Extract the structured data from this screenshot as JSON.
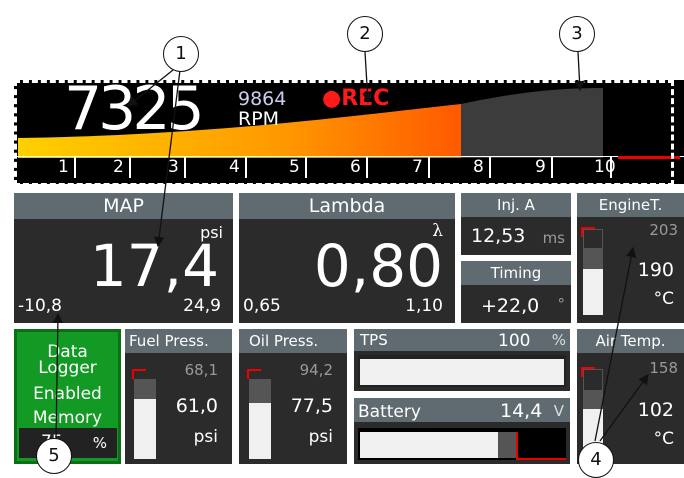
{
  "rpm": {
    "value": "7325",
    "peak": "9864",
    "unit": "RPM",
    "rec": "●REC",
    "scale": [
      "1",
      "2",
      "3",
      "4",
      "5",
      "6",
      "7",
      "8",
      "9",
      "10"
    ]
  },
  "map": {
    "title": "MAP",
    "value": "17,4",
    "unit": "psi",
    "min": "-10,8",
    "max": "24,9"
  },
  "lambda": {
    "title": "Lambda",
    "value": "0,80",
    "unit": "λ",
    "min": "0,65",
    "max": "1,10"
  },
  "inj": {
    "title": "Inj. A",
    "value": "12,53",
    "unit": "ms"
  },
  "timing": {
    "title": "Timing",
    "value": "+22,0",
    "unit": "°"
  },
  "enginet": {
    "title": "EngineT.",
    "max": "203",
    "value": "190",
    "unit": "°C",
    "fill": 0.55
  },
  "logger": {
    "line1": "Data",
    "line2": "Logger",
    "line3": "Enabled",
    "line4": "Memory",
    "value": "75",
    "unit": "%"
  },
  "fuel": {
    "title": "Fuel Press.",
    "max": "68,1",
    "value": "61,0",
    "unit": "psi",
    "fill": 0.85
  },
  "oil": {
    "title": "Oil Press.",
    "max": "94,2",
    "value": "77,5",
    "unit": "psi",
    "fill": 0.8
  },
  "tps": {
    "title": "TPS",
    "value": "100",
    "unit": "%",
    "fill": 1.0
  },
  "battery": {
    "title": "Battery",
    "value": "14,4",
    "unit": "V",
    "fill": 0.87
  },
  "airtemp": {
    "title": "Air Temp.",
    "max": "158",
    "value": "102",
    "unit": "°C",
    "fill": 0.6
  },
  "callouts": [
    "1",
    "2",
    "3",
    "4",
    "5"
  ]
}
